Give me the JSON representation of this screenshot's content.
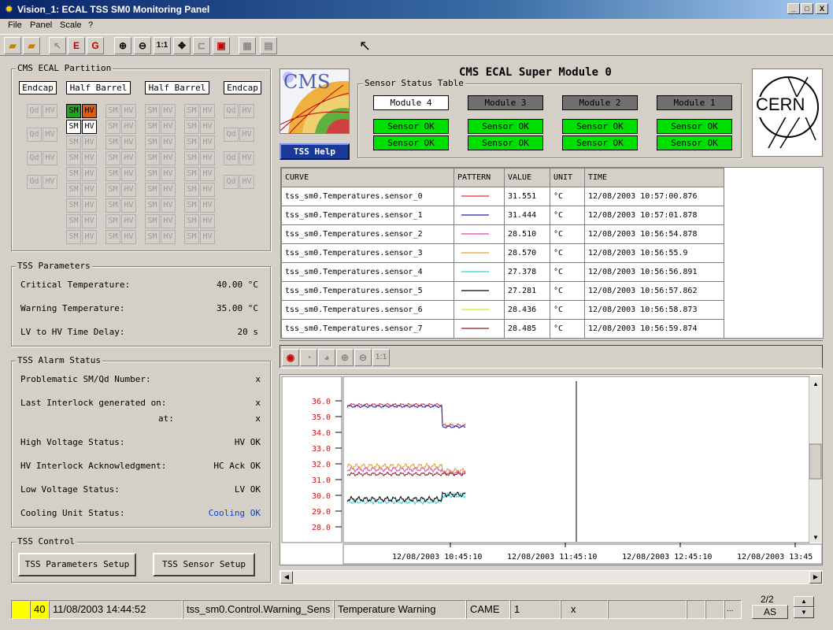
{
  "window": {
    "title": "Vision_1: ECAL TSS SM0 Monitoring Panel",
    "min": "_",
    "max": "□",
    "close": "X"
  },
  "menu": [
    "File",
    "Panel",
    "Scale",
    "?"
  ],
  "toolbar": {
    "zoom_1to1": "1:1"
  },
  "partition": {
    "title": "CMS ECAL Partition",
    "labels": [
      "Endcap",
      "Half Barrel",
      "Half Barrel",
      "Endcap"
    ],
    "sm": "SM",
    "hv": "HV",
    "qd": "Qd"
  },
  "params": {
    "title": "TSS Parameters",
    "rows": [
      {
        "label": "Critical Temperature:",
        "value": "40.00 °C"
      },
      {
        "label": "Warning Temperature:",
        "value": "35.00 °C"
      },
      {
        "label": "LV to HV Time Delay:",
        "value": "20 s"
      }
    ]
  },
  "alarm": {
    "title": "TSS Alarm Status",
    "rows": [
      {
        "label": "Problematic SM/Qd Number:",
        "value": "x"
      },
      {
        "label": "Last Interlock generated on:",
        "value": "x"
      },
      {
        "label": "at:",
        "value": "x"
      },
      {
        "label": "High Voltage Status:",
        "value": "HV OK"
      },
      {
        "label": "HV Interlock Acknowledgment:",
        "value": "HC Ack OK"
      },
      {
        "label": "Low Voltage Status:",
        "value": "LV OK"
      },
      {
        "label": "Cooling Unit Status:",
        "value": "Cooling OK"
      }
    ]
  },
  "control": {
    "title": "TSS Control",
    "params_btn": "TSS Parameters Setup",
    "sensor_btn": "TSS Sensor Setup"
  },
  "header": {
    "title": "CMS ECAL Super Module 0",
    "help_btn": "TSS Help",
    "cms_logo": "CMS",
    "cern_logo": "CERN"
  },
  "sensor_status": {
    "title": "Sensor Status Table",
    "modules": [
      "Module 4",
      "Module 3",
      "Module 2",
      "Module 1"
    ],
    "sensor_text": "Sensor OK"
  },
  "curves": {
    "headers": [
      "CURVE",
      "PATTERN",
      "VALUE",
      "UNIT",
      "TIME"
    ],
    "rows": [
      {
        "curve": "tss_sm0.Temperatures.sensor_0",
        "color": "#e03030",
        "value": "31.551",
        "unit": "°C",
        "time": "12/08/2003 10:57:00.876"
      },
      {
        "curve": "tss_sm0.Temperatures.sensor_1",
        "color": "#2020c0",
        "value": "31.444",
        "unit": "°C",
        "time": "12/08/2003 10:57:01.878"
      },
      {
        "curve": "tss_sm0.Temperatures.sensor_2",
        "color": "#e040c0",
        "value": "28.510",
        "unit": "°C",
        "time": "12/08/2003 10:56:54.878"
      },
      {
        "curve": "tss_sm0.Temperatures.sensor_3",
        "color": "#e0a030",
        "value": "28.570",
        "unit": "°C",
        "time": "12/08/2003 10:56:55.9"
      },
      {
        "curve": "tss_sm0.Temperatures.sensor_4",
        "color": "#30d0e0",
        "value": "27.378",
        "unit": "°C",
        "time": "12/08/2003 10:56:56.891"
      },
      {
        "curve": "tss_sm0.Temperatures.sensor_5",
        "color": "#000000",
        "value": "27.281",
        "unit": "°C",
        "time": "12/08/2003 10:56:57.862"
      },
      {
        "curve": "tss_sm0.Temperatures.sensor_6",
        "color": "#e0e030",
        "value": "28.436",
        "unit": "°C",
        "time": "12/08/2003 10:56:58.873"
      },
      {
        "curve": "tss_sm0.Temperatures.sensor_7",
        "color": "#802020",
        "value": "28.485",
        "unit": "°C",
        "time": "12/08/2003 10:56:59.874"
      }
    ]
  },
  "plot": {
    "plot_toolbar_1to1": "1:1",
    "y_ticks": [
      "36.0",
      "35.0",
      "34.0",
      "33.0",
      "32.0",
      "31.0",
      "30.0",
      "29.0",
      "28.0"
    ],
    "x_ticks": [
      "12/08/2003 10:45:10",
      "12/08/2003 11:45:10",
      "12/08/2003 12:45:10",
      "12/08/2003 13:45"
    ],
    "y_color": "#d01010"
  },
  "statusbar": {
    "priority": "40",
    "datetime": "11/08/2003 14:44:52",
    "dpe": "tss_sm0.Control.Warning_Sens",
    "text": "Temperature Warning",
    "direction": "CAME",
    "ack": "1",
    "x": "x",
    "more": "...",
    "page": "2/2",
    "mode": "AS"
  }
}
